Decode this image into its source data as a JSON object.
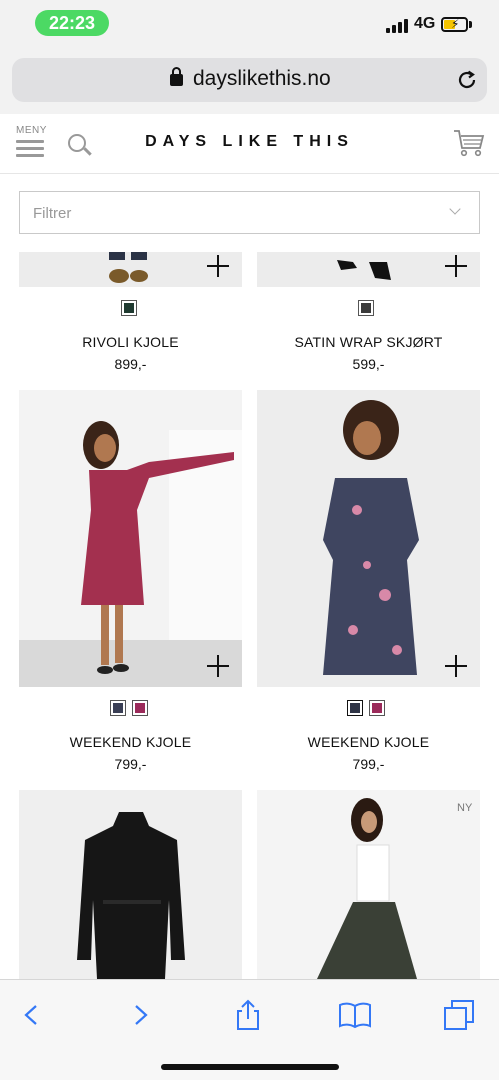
{
  "status_bar": {
    "time": "22:23",
    "network": "4G"
  },
  "browser": {
    "url": "dayslikethis.no"
  },
  "header": {
    "menu_label": "MENY",
    "logo": "DAYS LIKE THIS"
  },
  "filter": {
    "placeholder": "Filtrer"
  },
  "products": [
    {
      "name": "RIVOLI KJOLE",
      "price": "899,-",
      "swatches": [
        "#1f3a30"
      ]
    },
    {
      "name": "SATIN WRAP SKJØRT",
      "price": "599,-",
      "swatches": [
        "#3a3a3a"
      ]
    },
    {
      "name": "WEEKEND KJOLE",
      "price": "799,-",
      "swatches": [
        "#3a3f55",
        "#9b2a5a"
      ]
    },
    {
      "name": "WEEKEND KJOLE",
      "price": "799,-",
      "swatches": [
        "#2f3446",
        "#9b2a5a"
      ]
    },
    {
      "name": "",
      "price": "",
      "swatches": []
    },
    {
      "name": "",
      "price": "",
      "swatches": [],
      "badge": "NY"
    }
  ],
  "icons": {
    "menu": "hamburger-icon",
    "search": "search-icon",
    "cart": "cart-icon",
    "add": "plus-icon",
    "lock": "lock-icon",
    "reload": "reload-icon",
    "back": "back-icon",
    "forward": "forward-icon",
    "share": "share-icon",
    "bookmarks": "bookmarks-icon",
    "tabs": "tabs-icon"
  },
  "colors": {
    "time_pill": "#4cd964",
    "battery": "#f5c400",
    "toolbar_blue": "#3478f6"
  }
}
